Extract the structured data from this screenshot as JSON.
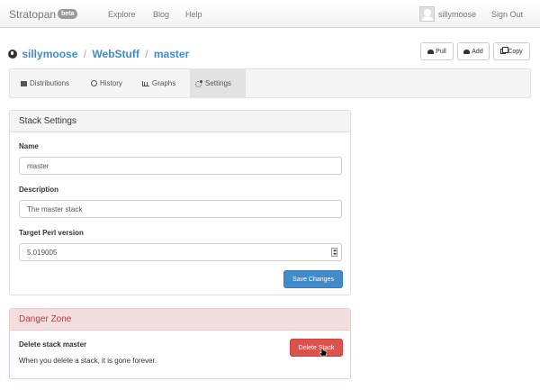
{
  "navbar": {
    "brand": "Stratopan",
    "badge": "beta",
    "links": [
      "Explore",
      "Blog",
      "Help"
    ],
    "username": "sillymoose",
    "signout": "Sign Out"
  },
  "breadcrumb": {
    "user": "sillymoose",
    "sep": "/",
    "repo": "WebStuff",
    "stack": "master"
  },
  "actions": {
    "pull": "Pull",
    "add": "Add",
    "copy": "Copy"
  },
  "tabs": [
    {
      "label": "Distributions",
      "icon": "box-icon"
    },
    {
      "label": "History",
      "icon": "clock-icon"
    },
    {
      "label": "Graphs",
      "icon": "chart-icon"
    },
    {
      "label": "Settings",
      "icon": "gear-icon",
      "active": true
    }
  ],
  "settings": {
    "title": "Stack Settings",
    "name_label": "Name",
    "name_value": "master",
    "desc_label": "Description",
    "desc_value": "The master stack",
    "perl_label": "Target Perl version",
    "perl_value": "5.019005",
    "save": "Save Changes"
  },
  "danger": {
    "title": "Danger Zone",
    "heading": "Delete stack master",
    "text": "When you delete a stack, it is gone forever.",
    "button": "Delete Stack"
  },
  "colors": {
    "primary": "#428bca",
    "danger": "#d9534f",
    "danger_bg": "#f2dede",
    "danger_text": "#a94442"
  }
}
